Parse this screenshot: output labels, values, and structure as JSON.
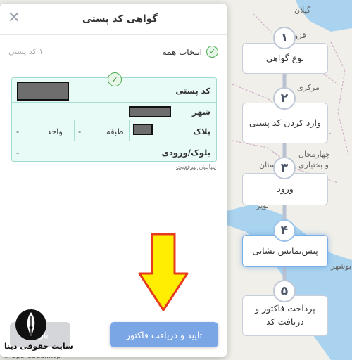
{
  "dialog": {
    "title": "گواهی کد پستی",
    "count_label": "۱ کد پستی",
    "select_all_label": "انتخاب همه",
    "table": {
      "postal_code_label": "کد پستی",
      "city_label": "شهر",
      "plaque_label": "پلاک",
      "floor_label": "طبقه",
      "floor_value": "-",
      "unit_label": "واحد",
      "unit_value": "-",
      "block_label": "بلوک/ورودی",
      "block_value": "-"
    },
    "show_location_link": "نمایش موقعیت",
    "back_button": "بازگ",
    "confirm_button": "تایید و دریافت فاکتور"
  },
  "steps": [
    {
      "number": "۱",
      "label": "نوع گواهی"
    },
    {
      "number": "۲",
      "label": "وارد کردن کد پستی"
    },
    {
      "number": "۳",
      "label": "ورود"
    },
    {
      "number": "۴",
      "label": "پیش‌نمایش نشانی"
    },
    {
      "number": "۵",
      "label": "پرداخت فاکتور و دریافت کد"
    }
  ],
  "map_labels": {
    "gilan": "گیلان",
    "qazvin": "قزو",
    "markazi": "مرکزی",
    "chaharmahal": "چهارمحال",
    "bakhtiari": "و بختیاری",
    "ostan": "ستان",
    "boyer": "بویر",
    "bushehr": "بوشهر"
  },
  "map_credit": "© Openstreetmap",
  "watermark": "سایت حقوقی دینا",
  "colors": {
    "primary_button": "#7ba6e6",
    "table_bg": "#e9fbf6",
    "check_green": "#4caf50",
    "arrow_yellow": "#ffee00"
  }
}
